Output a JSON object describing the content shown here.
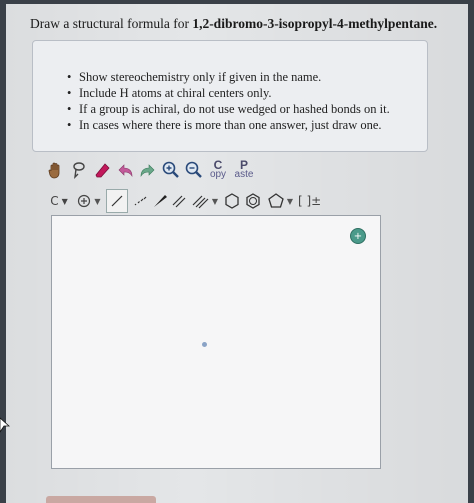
{
  "question": {
    "prefix": "Draw a structural formula for",
    "compound": "1,2-dibromo-3-isopropyl-4-methylpentane."
  },
  "instructions": [
    "Show stereochemistry only if given in the name.",
    "Include H atoms at chiral centers only.",
    "If a group is achiral, do not use wedged or hashed bonds on it.",
    "In cases where there is more than one answer, just draw one."
  ],
  "toolbar": {
    "copy_big": "C",
    "copy_small": "opy",
    "paste_big": "P",
    "paste_small": "aste",
    "atom_label": "C",
    "bracket_label": "[ ]±"
  },
  "canvas": {
    "zoom_symbol": "+"
  }
}
